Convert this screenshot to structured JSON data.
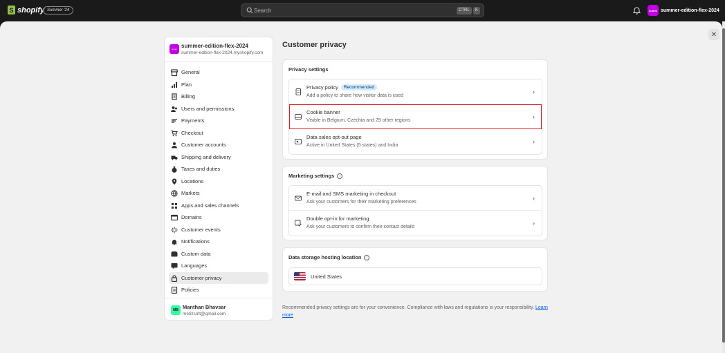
{
  "topbar": {
    "logo_text": "shopify",
    "edition_badge": "Summer '24",
    "search_placeholder": "Search",
    "search_shortcut_ctrl": "CTRL",
    "search_shortcut_key": "K",
    "store_avatar_text": "summ",
    "store_name": "summer-edition-flex-2024"
  },
  "sidebar": {
    "store_avatar_text": "summ",
    "store_name": "summer-edition-flex-2024",
    "store_domain": "summer-edition-flex-2024.myshopify.com",
    "items": [
      {
        "label": "General",
        "icon": "store-icon"
      },
      {
        "label": "Plan",
        "icon": "chart-bars-icon"
      },
      {
        "label": "Billing",
        "icon": "receipt-icon"
      },
      {
        "label": "Users and permissions",
        "icon": "users-icon"
      },
      {
        "label": "Payments",
        "icon": "payments-icon"
      },
      {
        "label": "Checkout",
        "icon": "cart-icon"
      },
      {
        "label": "Customer accounts",
        "icon": "person-icon"
      },
      {
        "label": "Shipping and delivery",
        "icon": "truck-icon"
      },
      {
        "label": "Taxes and duties",
        "icon": "money-bag-icon"
      },
      {
        "label": "Locations",
        "icon": "location-pin-icon"
      },
      {
        "label": "Markets",
        "icon": "globe-icon"
      },
      {
        "label": "Apps and sales channels",
        "icon": "apps-grid-icon"
      },
      {
        "label": "Domains",
        "icon": "domain-icon"
      },
      {
        "label": "Customer events",
        "icon": "sparkle-icon"
      },
      {
        "label": "Notifications",
        "icon": "bell-icon"
      },
      {
        "label": "Custom data",
        "icon": "database-icon"
      },
      {
        "label": "Languages",
        "icon": "language-icon"
      },
      {
        "label": "Customer privacy",
        "icon": "lock-icon"
      },
      {
        "label": "Policies",
        "icon": "policy-icon"
      }
    ],
    "active_item": "Customer privacy",
    "user": {
      "initials": "MB",
      "name": "Manthan Bhavsar",
      "email": "metizsoft@gmail.com"
    }
  },
  "main": {
    "title": "Customer privacy",
    "privacy_settings": {
      "title": "Privacy settings",
      "rows": [
        {
          "title": "Privacy policy",
          "badge": "Recommended",
          "subtitle": "Add a policy to share how visitor data is used",
          "icon": "policy-doc-icon"
        },
        {
          "title": "Cookie banner",
          "subtitle": "Visible in Belgium, Czechia and 29 other regions",
          "icon": "cookie-banner-icon"
        },
        {
          "title": "Data sales opt-out page",
          "subtitle": "Active in United States (5 states) and India",
          "icon": "opt-out-icon"
        }
      ]
    },
    "marketing_settings": {
      "title": "Marketing settings",
      "rows": [
        {
          "title": "E-mail and SMS marketing in checkout",
          "subtitle": "Ask your customers for their marketing preferences",
          "icon": "email-icon"
        },
        {
          "title": "Double opt-in for marketing",
          "subtitle": "Ask your customers to confirm their contact details",
          "icon": "double-opt-in-icon"
        }
      ]
    },
    "data_storage": {
      "title": "Data storage hosting location",
      "country": "United States",
      "flag": "us-flag-icon"
    },
    "footnote_text": "Recommended privacy settings are for your convenience. Compliance with laws and regulations is your responsibility.",
    "footnote_link": "Learn more"
  },
  "colors": {
    "topbar_bg": "#1a1a1a",
    "page_bg": "#f1f1f1",
    "store_avatar": "#c200e6",
    "user_avatar": "#36fba1",
    "highlight_outline": "#e02020",
    "badge_bg": "#d5ebff",
    "link": "#005bd3"
  }
}
